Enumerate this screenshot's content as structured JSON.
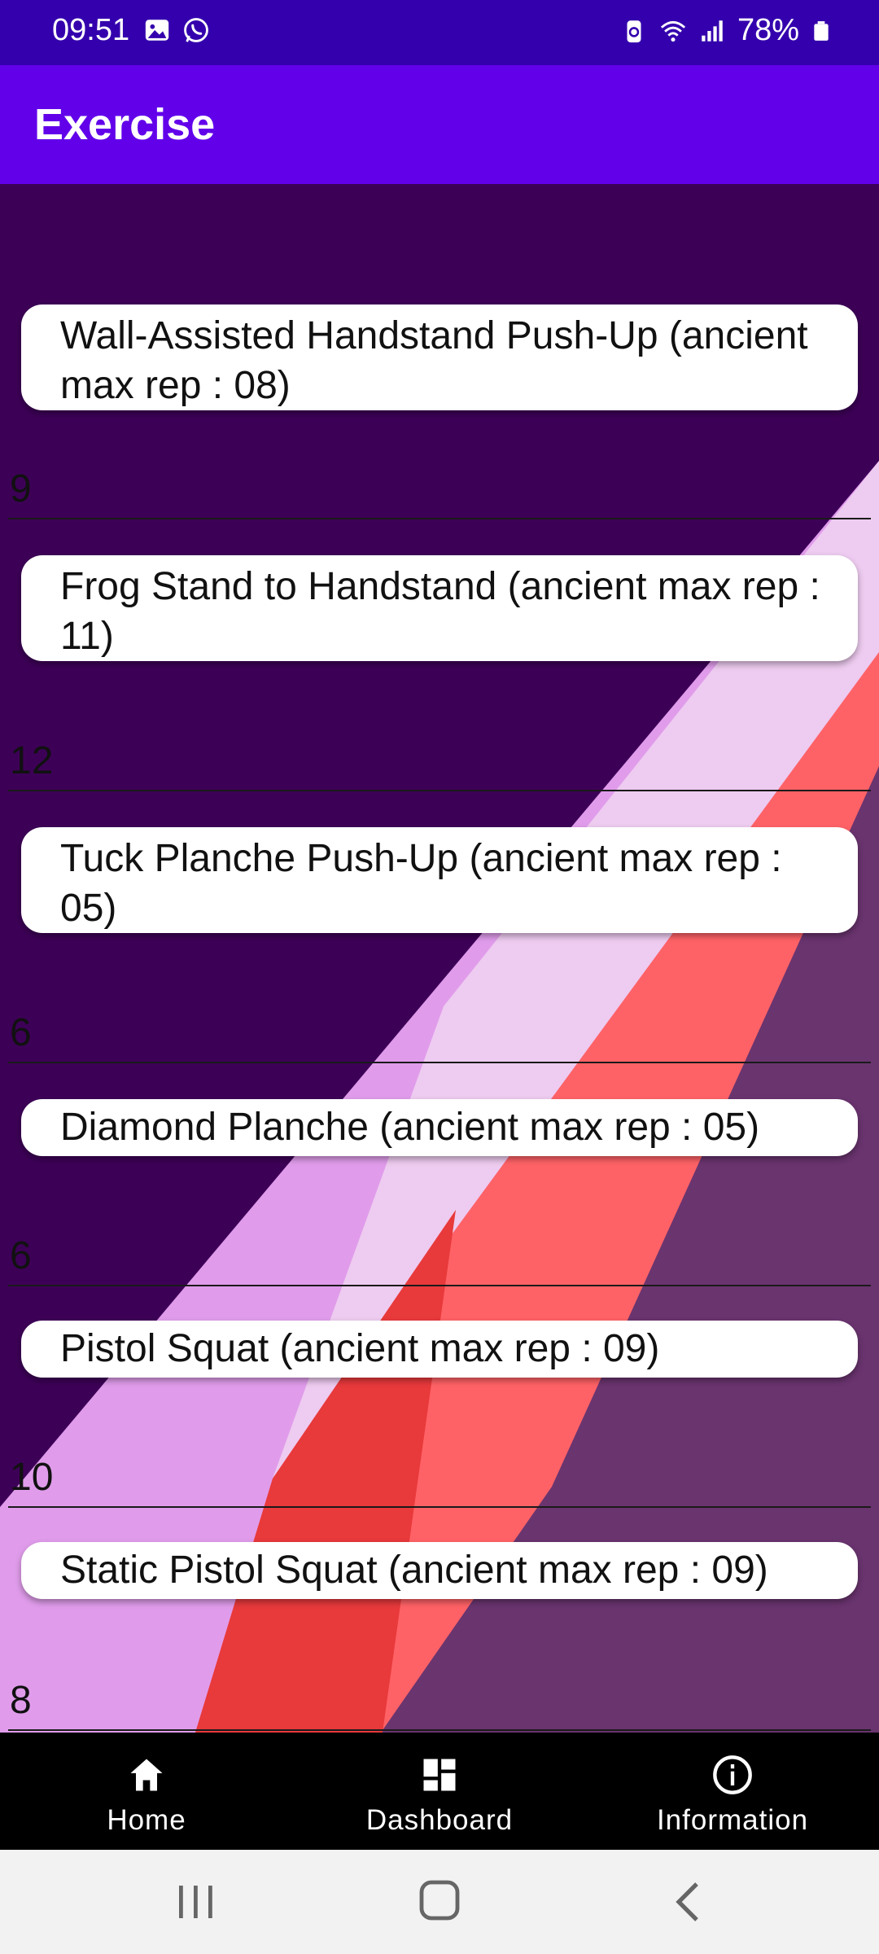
{
  "status_bar": {
    "time": "09:51",
    "battery": "78%",
    "icons": [
      "gallery-icon",
      "whatsapp-icon",
      "data-saver-icon",
      "wifi-icon",
      "signal-icon",
      "battery-icon"
    ]
  },
  "app_bar": {
    "title": "Exercise"
  },
  "exercises": [
    {
      "name": "Wall-Assisted Handstand Push-Up (ancient max rep : 08)",
      "reps": "9"
    },
    {
      "name": "Frog Stand to Handstand (ancient max rep : 11)",
      "reps": "12"
    },
    {
      "name": "Tuck Planche Push-Up (ancient max rep : 05)",
      "reps": "6"
    },
    {
      "name": "Diamond Planche (ancient max rep : 05)",
      "reps": "6"
    },
    {
      "name": "Pistol Squat (ancient max rep : 09)",
      "reps": "10"
    },
    {
      "name": "Static Pistol Squat (ancient max rep : 09)",
      "reps": "8"
    }
  ],
  "bottom_nav": {
    "items": [
      {
        "label": "Home",
        "icon": "home-icon"
      },
      {
        "label": "Dashboard",
        "icon": "dashboard-icon"
      },
      {
        "label": "Information",
        "icon": "info-icon"
      }
    ]
  },
  "colors": {
    "status_bar": "#3400ad",
    "app_bar": "#6200ea",
    "background": "#3d0057",
    "stripe_light_pink": "#eecbf0",
    "stripe_coral": "#ff6266",
    "stripe_mauve": "#6a346f",
    "stripe_lilac": "#e09ceb",
    "stripe_red": "#e8393b"
  }
}
